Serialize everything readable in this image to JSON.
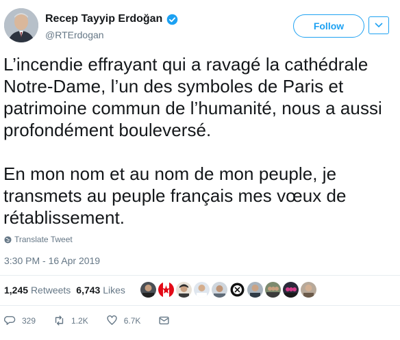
{
  "tweet": {
    "display_name": "Recep Tayyip Erdoğan",
    "handle": "@RTErdogan",
    "follow_label": "Follow",
    "paragraphs": [
      "L’incendie effrayant qui a ravagé la cathédrale Notre-Dame, l’un des symboles de Paris et patrimoine commun de l’humanité, nous a aussi profondément bouleversé.",
      "En mon nom et au nom de mon peuple, je transmets au peuple français mes vœux de rétablissement."
    ],
    "translate_label": "Translate Tweet",
    "timestamp": "3:30 PM - 16 Apr 2019"
  },
  "stats": {
    "retweets_count": "1,245",
    "retweets_label": "Retweets",
    "likes_count": "6,743",
    "likes_label": "Likes"
  },
  "actions": {
    "reply_count": "329",
    "retweet_count": "1.2K",
    "like_count": "6.7K"
  },
  "colors": {
    "accent": "#1da1f2",
    "muted": "#657786",
    "text": "#14171a",
    "verified": "#1da1f2"
  },
  "icons": [
    "verified-badge-icon",
    "chevron-down-icon",
    "globe-icon",
    "reply-icon",
    "retweet-icon",
    "heart-icon",
    "mail-icon"
  ]
}
